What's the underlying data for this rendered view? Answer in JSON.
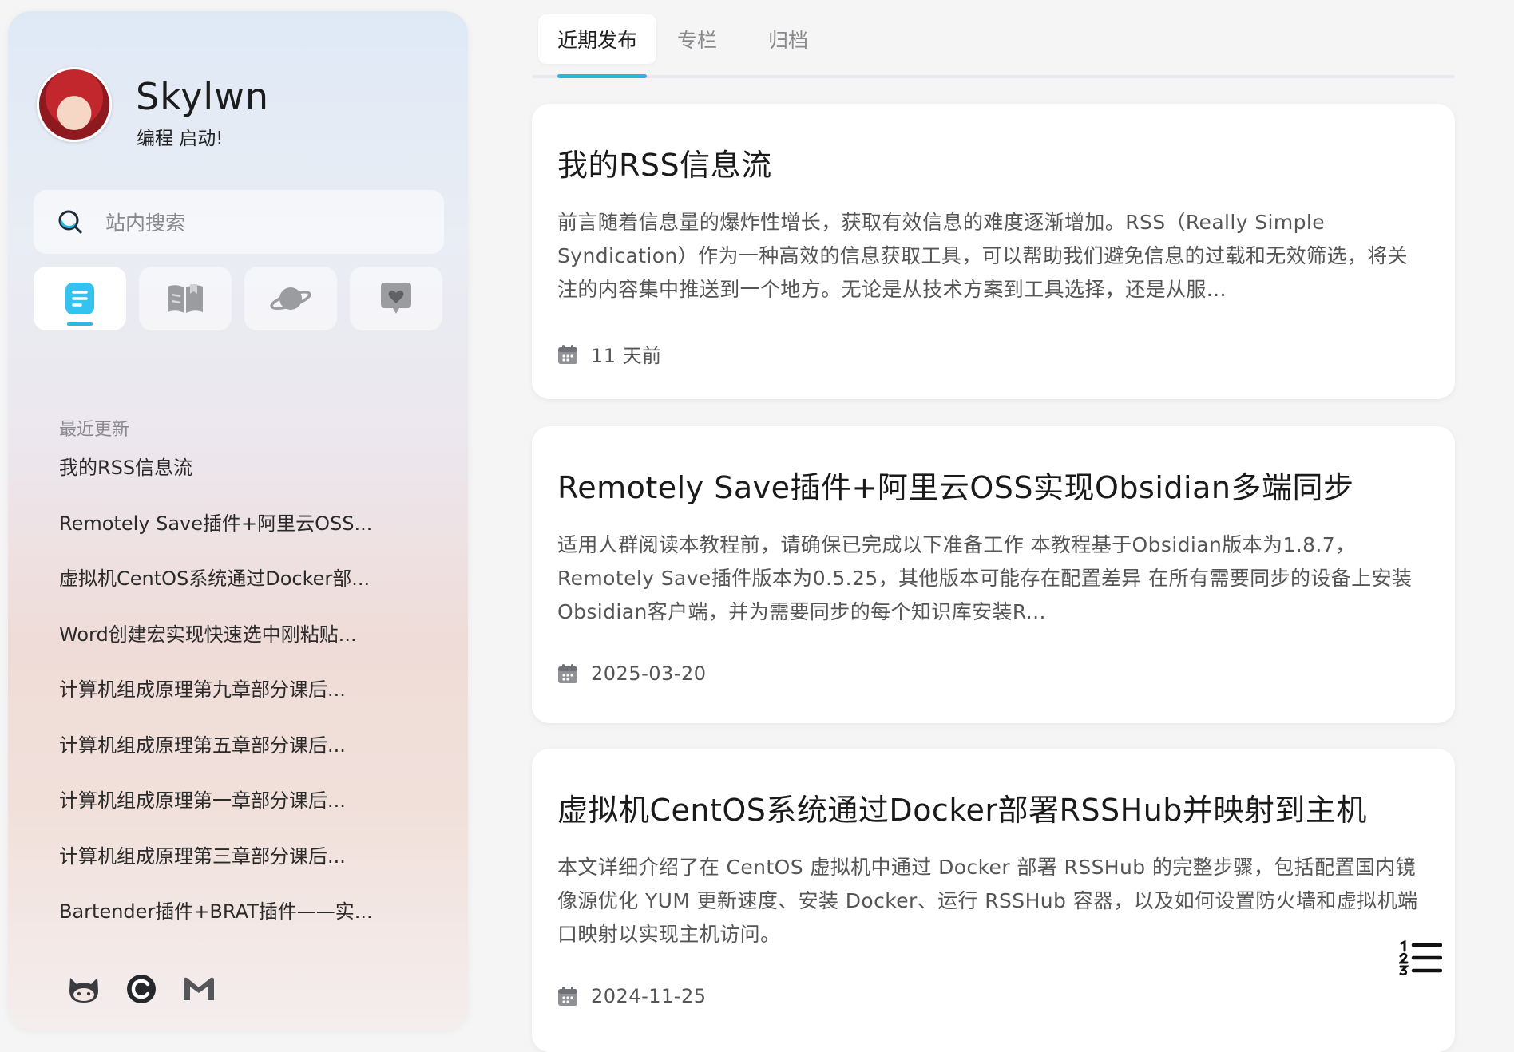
{
  "profile": {
    "name": "Skylwn",
    "motto": "编程 启动!"
  },
  "search": {
    "placeholder": "站内搜索"
  },
  "nav_tiles": [
    {
      "icon": "document-icon",
      "active": true
    },
    {
      "icon": "book-icon",
      "active": false
    },
    {
      "icon": "planet-icon",
      "active": false
    },
    {
      "icon": "heart-chat-icon",
      "active": false
    }
  ],
  "recent": {
    "heading": "最近更新",
    "items": [
      "我的RSS信息流",
      "Remotely Save插件+阿里云OSS...",
      "虚拟机CentOS系统通过Docker部...",
      "Word创建宏实现快速选中刚粘贴...",
      "计算机组成原理第九章部分课后...",
      "计算机组成原理第五章部分课后...",
      "计算机组成原理第一章部分课后...",
      "计算机组成原理第三章部分课后...",
      "Bartender插件+BRAT插件——实..."
    ]
  },
  "social": [
    "github-icon",
    "csdn-icon",
    "gmail-icon"
  ],
  "tabs": [
    "近期发布",
    "专栏",
    "归档"
  ],
  "posts": [
    {
      "title": "我的RSS信息流",
      "excerpt": "前言随着信息量的爆炸性增长，获取有效信息的难度逐渐增加。RSS（Really Simple Syndication）作为一种高效的信息获取工具，可以帮助我们避免信息的过载和无效筛选，将关注的内容集中推送到一个地方。无论是从技术方案到工具选择，还是从服...",
      "date": "11 天前"
    },
    {
      "title": "Remotely Save插件+阿里云OSS实现Obsidian多端同步",
      "excerpt": "适用人群阅读本教程前，请确保已完成以下准备工作 本教程基于Obsidian版本为1.8.7，Remotely Save插件版本为0.5.25，其他版本可能存在配置差异 在所有需要同步的设备上安装Obsidian客户端，并为需要同步的每个知识库安装R...",
      "date": "2025-03-20"
    },
    {
      "title": "虚拟机CentOS系统通过Docker部署RSSHub并映射到主机",
      "excerpt": "本文详细介绍了在 CentOS 虚拟机中通过 Docker 部署 RSSHub 的完整步骤，包括配置国内镜像源优化 YUM 更新速度、安装 Docker、运行 RSSHub 容器，以及如何设置防火墙和虚拟机端口映射以实现主机访问。",
      "date": "2024-11-25"
    }
  ],
  "colors": {
    "accent": "#2bb6df",
    "sidebar_top": "#dfe9f6",
    "sidebar_bottom": "#f1e0da"
  }
}
